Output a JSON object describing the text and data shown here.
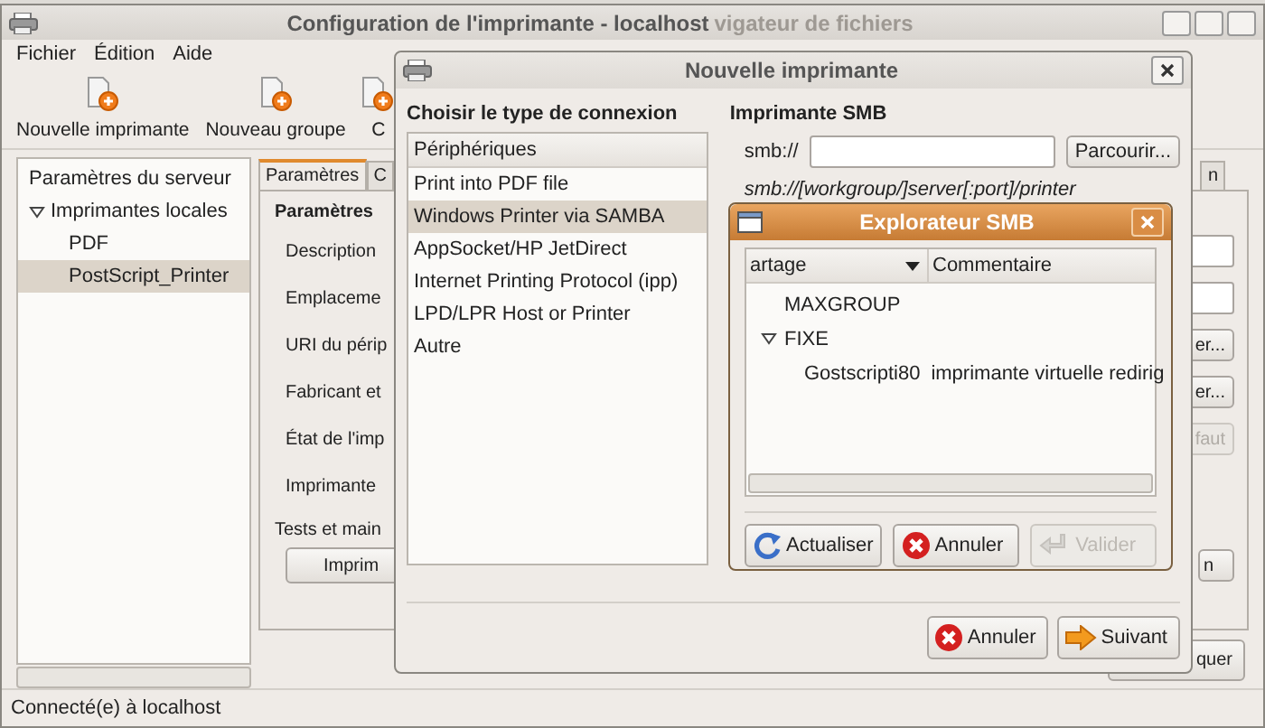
{
  "main_window": {
    "title": "Configuration de l'imprimante - localhost",
    "ghost_title": "vigateur de fichiers",
    "menu": [
      {
        "label": "Fichier"
      },
      {
        "label": "Édition"
      },
      {
        "label": "Aide"
      }
    ],
    "toolbar": [
      {
        "label": "Nouvelle imprimante"
      },
      {
        "label": "Nouveau groupe"
      },
      {
        "label": "C"
      }
    ],
    "tree": [
      {
        "label": "Paramètres du serveur",
        "selected": false
      },
      {
        "label": "Imprimantes locales",
        "selected": false,
        "expanded": true,
        "children": [
          {
            "label": "PDF",
            "selected": false
          },
          {
            "label": "PostScript_Printer",
            "selected": true
          }
        ]
      }
    ],
    "tabs": [
      {
        "label": "Paramètres",
        "selected": true
      },
      {
        "label": "C",
        "selected": false
      },
      {
        "label": "n",
        "selected": false
      }
    ],
    "section_title": "Paramètres",
    "rows": [
      {
        "label": "Description",
        "kind": "field",
        "disabled": false
      },
      {
        "label": "Emplaceme",
        "kind": "field",
        "disabled": false
      },
      {
        "label": "URI du périp",
        "kind": "button",
        "control_label": "er...",
        "disabled": false
      },
      {
        "label": "Fabricant et",
        "kind": "button",
        "control_label": "er...",
        "disabled": false
      },
      {
        "label": "État de l'imp",
        "kind": "button",
        "control_label": "faut",
        "disabled": true
      },
      {
        "label": "Imprimante"
      }
    ],
    "tests_label": "Tests et main",
    "tests_buttons": [
      {
        "label": "Imprim"
      },
      {
        "label": "n"
      }
    ],
    "bottom_button": "quer",
    "status": "Connecté(e) à localhost"
  },
  "new_printer_dialog": {
    "title": "Nouvelle imprimante",
    "heading": "Choisir le type de connexion",
    "list_header": "Périphériques",
    "devices": [
      {
        "label": "Print into PDF file",
        "selected": false
      },
      {
        "label": "Windows Printer via SAMBA",
        "selected": true
      },
      {
        "label": "AppSocket/HP JetDirect",
        "selected": false
      },
      {
        "label": "Internet Printing Protocol (ipp)",
        "selected": false
      },
      {
        "label": "LPD/LPR Host or Printer",
        "selected": false
      },
      {
        "label": "Autre",
        "selected": false
      }
    ],
    "smb_title": "Imprimante SMB",
    "smb_label": "smb://",
    "browse_button": "Parcourir...",
    "hint": "smb://[workgroup/]server[:port]/printer",
    "buttons": [
      {
        "label": "Annuler",
        "kind": "cancel",
        "disabled": false
      },
      {
        "label": "Suivant",
        "kind": "next",
        "disabled": false
      }
    ]
  },
  "smb_explorer": {
    "title": "Explorateur SMB",
    "columns": [
      {
        "label": "artage",
        "sorted": true
      },
      {
        "label": "Commentaire",
        "sorted": false
      }
    ],
    "tree": [
      {
        "name": "MAXGROUP"
      },
      {
        "name": "FIXE",
        "expanded": true,
        "children": [
          {
            "name": "Gostscripti80",
            "comment": "imprimante virtuelle redirig"
          }
        ]
      }
    ],
    "buttons": [
      {
        "label": "Actualiser",
        "kind": "refresh",
        "disabled": false
      },
      {
        "label": "Annuler",
        "kind": "cancel",
        "disabled": false
      },
      {
        "label": "Valider",
        "kind": "ok",
        "disabled": true
      }
    ]
  }
}
